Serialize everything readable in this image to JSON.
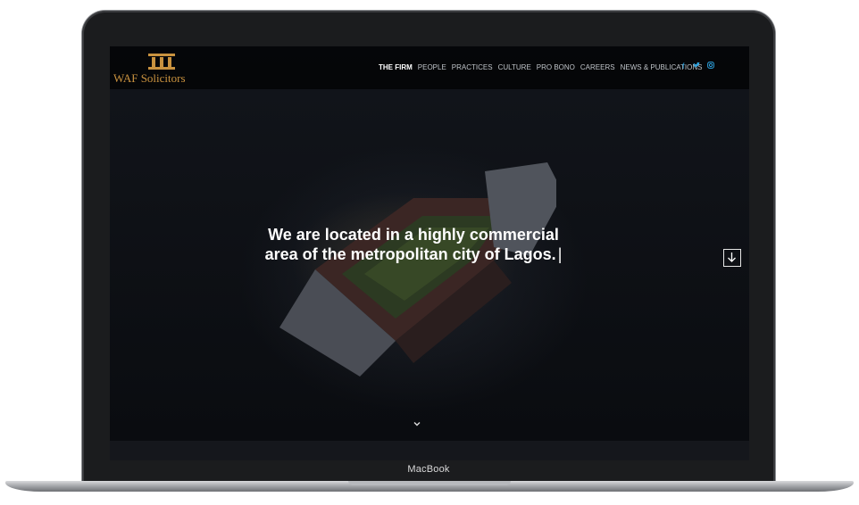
{
  "device": {
    "label": "MacBook"
  },
  "site": {
    "logo_text": "WAF Solicitors",
    "nav": [
      {
        "label": "THE FIRM",
        "active": true
      },
      {
        "label": "PEOPLE",
        "active": false
      },
      {
        "label": "PRACTICES",
        "active": false
      },
      {
        "label": "CULTURE",
        "active": false
      },
      {
        "label": "PRO BONO",
        "active": false
      },
      {
        "label": "CAREERS",
        "active": false
      },
      {
        "label": "NEWS & PUBLICATIONS",
        "active": false
      }
    ],
    "social_icons": [
      "facebook-icon",
      "twitter-icon",
      "instagram-icon"
    ],
    "social_glyphs": {
      "facebook": "f",
      "twitter": "🐦",
      "instagram": "◎"
    },
    "hero": {
      "headline_line1": "We are located in a highly commercial",
      "headline_line2": "area of the metropolitan city of Lagos.",
      "cursor": "|"
    },
    "colors": {
      "brand_gold": "#c9923f",
      "social_blue": "#2ea3e0"
    }
  }
}
